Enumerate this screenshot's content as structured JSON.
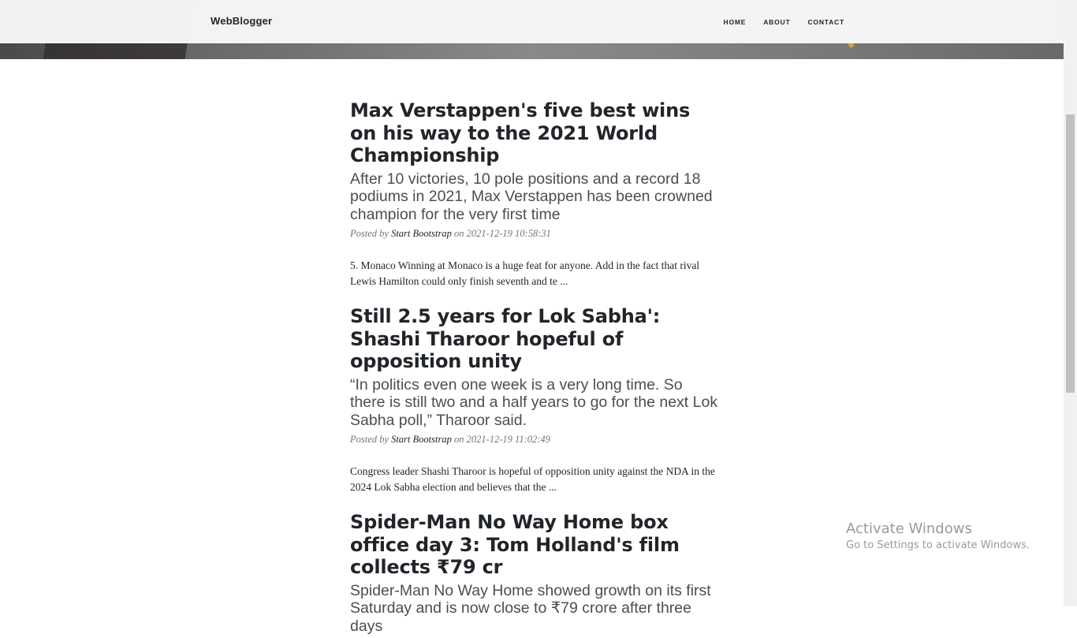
{
  "navbar": {
    "brand": "WebBlogger",
    "links": [
      "HOME",
      "ABOUT",
      "CONTACT"
    ]
  },
  "posts": [
    {
      "title": "Max Verstappen's five best wins on his way to the 2021 World Championship",
      "subtitle": "After 10 victories, 10 pole positions and a record 18 podiums in 2021, Max Verstappen has been crowned champion for the very first time",
      "meta_prefix": "Posted by",
      "author": "Start Bootstrap",
      "meta_on": "on",
      "date": "2021-12-19 10:58:31",
      "excerpt": "5. Monaco Winning at Monaco is a huge feat for anyone. Add in the fact that rival Lewis Hamilton could only finish seventh and te ..."
    },
    {
      "title": "Still 2.5 years for Lok Sabha': Shashi Tharoor hopeful of opposition unity",
      "subtitle": "“In politics even one week is a very long time. So there is still two and a half years to go for the next Lok Sabha poll,” Tharoor said.",
      "meta_prefix": "Posted by",
      "author": "Start Bootstrap",
      "meta_on": "on",
      "date": "2021-12-19 11:02:49",
      "excerpt": "Congress leader Shashi Tharoor is hopeful of opposition unity against the NDA in the 2024 Lok Sabha election and believes that the ..."
    },
    {
      "title": "Spider-Man No Way Home box office day 3: Tom Holland's film collects ₹79 cr",
      "subtitle": "Spider-Man No Way Home showed growth on its first Saturday and is now close to ₹79 crore after three days"
    }
  ],
  "watermark": {
    "line1": "Activate Windows",
    "line2": "Go to Settings to activate Windows."
  }
}
